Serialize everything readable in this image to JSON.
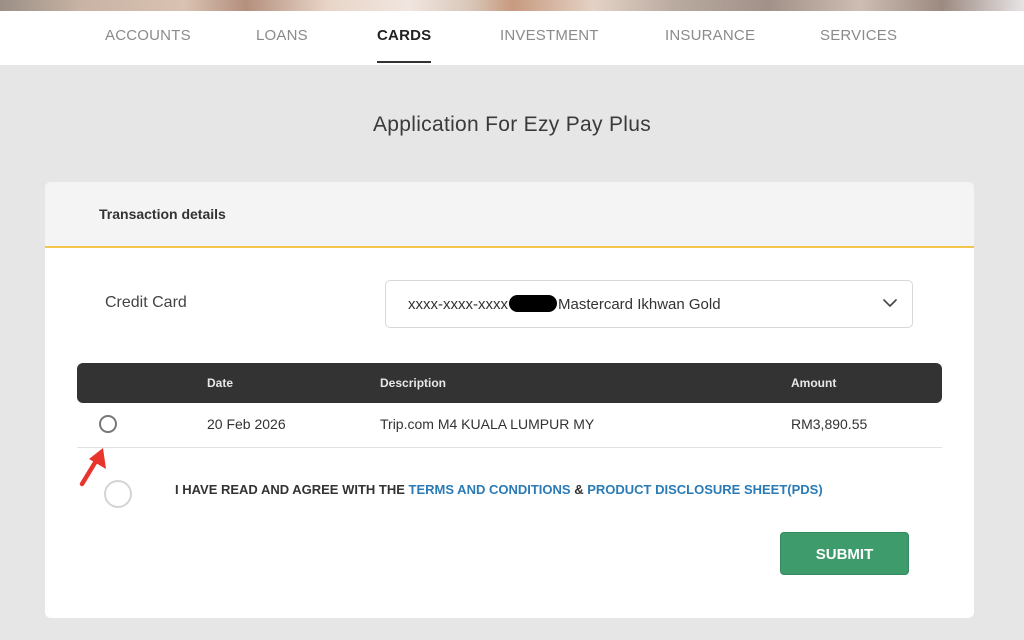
{
  "nav": {
    "items": [
      {
        "label": "ACCOUNTS"
      },
      {
        "label": "LOANS"
      },
      {
        "label": "CARDS"
      },
      {
        "label": "INVESTMENT"
      },
      {
        "label": "INSURANCE"
      },
      {
        "label": "SERVICES"
      }
    ],
    "active": "CARDS"
  },
  "page_title": "Application For Ezy Pay Plus",
  "section": {
    "title": "Transaction details"
  },
  "credit_card": {
    "label": "Credit Card",
    "masked_prefix": "xxxx-xxxx-xxxx",
    "card_name": "Mastercard Ikhwan Gold",
    "dropdown_icon": "chevron-down-icon"
  },
  "table": {
    "headers": {
      "date": "Date",
      "description": "Description",
      "amount": "Amount"
    },
    "rows": [
      {
        "date": "20 Feb 2026",
        "description": "Trip.com M4 KUALA LUMPUR MY",
        "amount": "RM3,890.55",
        "selected": false
      }
    ]
  },
  "agreement": {
    "prefix": "I HAVE READ AND AGREE WITH THE",
    "terms_link": "TERMS AND CONDITIONS",
    "joiner": "&",
    "pds_link": "PRODUCT DISCLOSURE SHEET(PDS)",
    "checked": false
  },
  "submit_label": "SUBMIT",
  "colors": {
    "accent_underline": "#f3c54a",
    "submit": "#3d9b6c",
    "link": "#2a7bb5",
    "table_header": "#333333",
    "annotation_arrow": "#e8342c"
  }
}
